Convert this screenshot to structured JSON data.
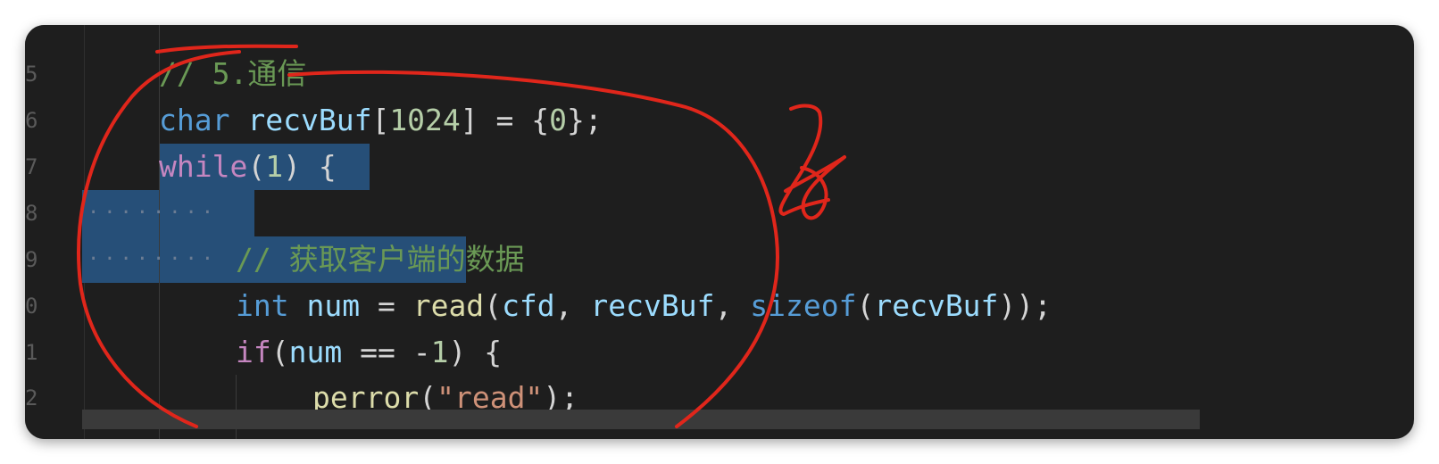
{
  "editor": {
    "theme_colors": {
      "background": "#1e1e1e",
      "comment": "#6a9955",
      "keyword": "#569cd6",
      "control": "#c586c0",
      "variable": "#9cdcfe",
      "number": "#b5cea8",
      "function": "#dcdcaa",
      "string": "#ce9178",
      "selection": "#264f78",
      "annotation": "#e0261b"
    },
    "line_numbers": [
      "5",
      "6",
      "7",
      "8",
      "9",
      "0",
      "1",
      "2"
    ],
    "lines": [
      {
        "tokens": [
          {
            "t": "// 5.通信",
            "c": "comment"
          }
        ]
      },
      {
        "tokens": [
          {
            "t": "char",
            "c": "keyword"
          },
          {
            "t": " ",
            "c": "punc"
          },
          {
            "t": "recvBuf",
            "c": "var"
          },
          {
            "t": "[",
            "c": "punc"
          },
          {
            "t": "1024",
            "c": "num"
          },
          {
            "t": "] = {",
            "c": "punc"
          },
          {
            "t": "0",
            "c": "num"
          },
          {
            "t": "};",
            "c": "punc"
          }
        ]
      },
      {
        "tokens": [
          {
            "t": "while",
            "c": "control"
          },
          {
            "t": "(",
            "c": "punc"
          },
          {
            "t": "1",
            "c": "num"
          },
          {
            "t": ") {",
            "c": "punc"
          }
        ]
      },
      {
        "tokens": []
      },
      {
        "tokens": [
          {
            "t": "// 获取客户端的数据",
            "c": "comment"
          }
        ]
      },
      {
        "tokens": [
          {
            "t": "int",
            "c": "keyword"
          },
          {
            "t": " ",
            "c": "punc"
          },
          {
            "t": "num",
            "c": "var"
          },
          {
            "t": " = ",
            "c": "punc"
          },
          {
            "t": "read",
            "c": "fn"
          },
          {
            "t": "(",
            "c": "punc"
          },
          {
            "t": "cfd",
            "c": "var"
          },
          {
            "t": ", ",
            "c": "punc"
          },
          {
            "t": "recvBuf",
            "c": "var"
          },
          {
            "t": ", ",
            "c": "punc"
          },
          {
            "t": "sizeof",
            "c": "keyword"
          },
          {
            "t": "(",
            "c": "punc"
          },
          {
            "t": "recvBuf",
            "c": "var"
          },
          {
            "t": "));",
            "c": "punc"
          }
        ]
      },
      {
        "tokens": [
          {
            "t": "if",
            "c": "control"
          },
          {
            "t": "(",
            "c": "punc"
          },
          {
            "t": "num",
            "c": "var"
          },
          {
            "t": " == -",
            "c": "punc"
          },
          {
            "t": "1",
            "c": "num"
          },
          {
            "t": ") {",
            "c": "punc"
          }
        ]
      },
      {
        "tokens": [
          {
            "t": "perror",
            "c": "fn"
          },
          {
            "t": "(",
            "c": "punc"
          },
          {
            "t": "\"read\"",
            "c": "str"
          },
          {
            "t": ");",
            "c": "punc"
          }
        ]
      }
    ],
    "whitespace_marker": "········",
    "annotation_glyph": "了"
  }
}
